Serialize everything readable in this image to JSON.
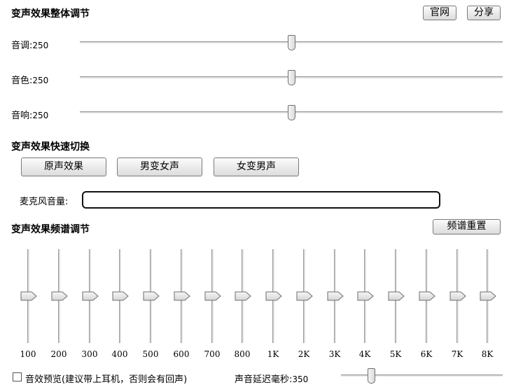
{
  "overall": {
    "title": "变声效果整体调节",
    "official_site_label": "官网",
    "share_label": "分享",
    "sliders": [
      {
        "label": "音调",
        "value": "250"
      },
      {
        "label": "音色",
        "value": "250"
      },
      {
        "label": "音响",
        "value": "250"
      }
    ]
  },
  "quick": {
    "title": "变声效果快速切换",
    "buttons": [
      "原声效果",
      "男变女声",
      "女变男声"
    ]
  },
  "mic": {
    "label": "麦克风音量",
    "value_fraction": 0.0
  },
  "eq": {
    "title": "变声效果频谱调节",
    "reset_label": "频谱重置",
    "bands": [
      "100",
      "200",
      "300",
      "400",
      "500",
      "600",
      "700",
      "800",
      "1K",
      "2K",
      "3K",
      "4K",
      "5K",
      "6K",
      "7K",
      "8K"
    ],
    "level_fraction": 0.5
  },
  "footer": {
    "preview_label": "音效预览(建议带上耳机，否则会有回声)",
    "preview_checked": false,
    "delay_label": "声音延迟毫秒",
    "delay_value": "350"
  }
}
